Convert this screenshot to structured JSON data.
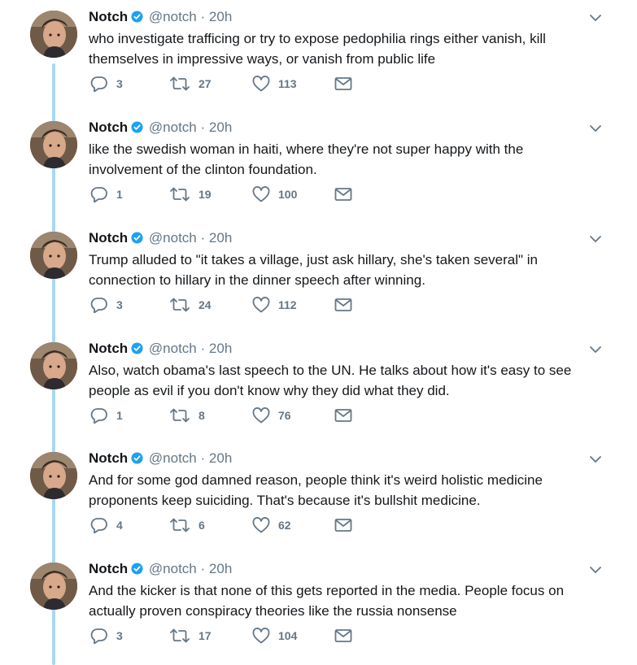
{
  "tweets": [
    {
      "name": "Notch",
      "handle": "@notch",
      "separator": "·",
      "time": "20h",
      "lines": [
        "who investigate trafficing or try to expose pedophilia rings either vanish, kill",
        "themselves in impressive ways, or vanish from public life"
      ],
      "replies": "3",
      "retweets": "27",
      "likes": "113"
    },
    {
      "name": "Notch",
      "handle": "@notch",
      "separator": "·",
      "time": "20h",
      "lines": [
        "like the swedish woman in haiti, where they're not super happy with the",
        "involvement of the clinton foundation."
      ],
      "replies": "1",
      "retweets": "19",
      "likes": "100"
    },
    {
      "name": "Notch",
      "handle": "@notch",
      "separator": "·",
      "time": "20h",
      "lines": [
        "Trump alluded to \"it takes a village, just ask hillary, she's taken several\" in",
        "connection to hillary in the dinner speech after winning."
      ],
      "replies": "3",
      "retweets": "24",
      "likes": "112"
    },
    {
      "name": "Notch",
      "handle": "@notch",
      "separator": "·",
      "time": "20h",
      "lines": [
        "Also, watch obama's last speech to the UN. He talks about how it's easy to see",
        "people as evil if you don't know why they did what they did."
      ],
      "replies": "1",
      "retweets": "8",
      "likes": "76"
    },
    {
      "name": "Notch",
      "handle": "@notch",
      "separator": "·",
      "time": "20h",
      "lines": [
        "And for some god damned reason, people think it's weird holistic medicine",
        "proponents keep suiciding. That's because it's bullshit medicine."
      ],
      "replies": "4",
      "retweets": "6",
      "likes": "62"
    },
    {
      "name": "Notch",
      "handle": "@notch",
      "separator": "·",
      "time": "20h",
      "lines": [
        "And the kicker is that none of this gets reported in the media. People focus on",
        "actually proven conspiracy theories like the russia nonsense"
      ],
      "replies": "3",
      "retweets": "17",
      "likes": "104"
    }
  ],
  "icons": {
    "verified": "verified-badge-icon",
    "caret": "chevron-down-icon",
    "reply": "reply-icon",
    "retweet": "retweet-icon",
    "like": "heart-icon",
    "dm": "envelope-icon"
  },
  "colors": {
    "text": "#14171a",
    "muted": "#657786",
    "verified": "#1da1f2",
    "thread_line": "#a9d7f1"
  }
}
